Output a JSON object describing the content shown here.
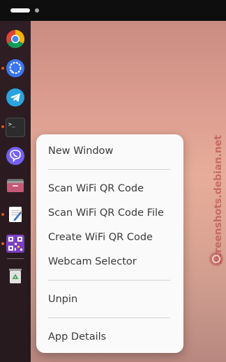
{
  "topbar": {
    "workspaces": [
      "active",
      "inactive"
    ]
  },
  "dock": {
    "apps": [
      {
        "name": "chrome-icon",
        "running": false
      },
      {
        "name": "signal-icon",
        "running": true
      },
      {
        "name": "telegram-icon",
        "running": false
      },
      {
        "name": "terminal-icon",
        "running": true
      },
      {
        "name": "viber-icon",
        "running": false
      },
      {
        "name": "files-icon",
        "running": false
      },
      {
        "name": "text-editor-icon",
        "running": true
      },
      {
        "name": "qr-code-app-icon",
        "running": true
      },
      {
        "name": "trash-icon",
        "running": false
      }
    ],
    "terminal_prompt": ">_"
  },
  "watermark": {
    "text": "screenshots.debian.net",
    "color": "#b03a3a"
  },
  "context_menu": {
    "items": [
      "New Window",
      "Scan WiFi QR Code",
      "Scan WiFi QR Code File",
      "Create WiFi QR Code",
      "Webcam Selector",
      "Unpin",
      "App Details"
    ]
  },
  "colors": {
    "running_indicator": "#e95420",
    "menu_background": "#fafafa",
    "menu_text": "#3a3a3a"
  }
}
